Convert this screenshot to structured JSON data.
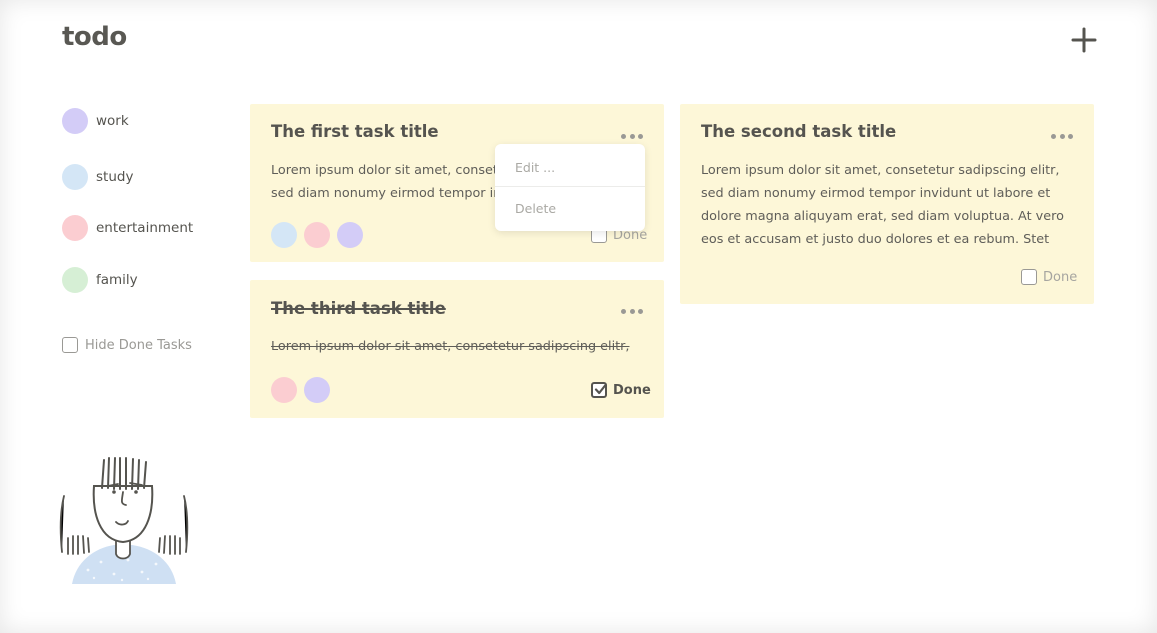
{
  "app": {
    "title": "todo"
  },
  "header": {
    "add_icon": "plus-icon"
  },
  "sidebar": {
    "tags": [
      {
        "label": "work",
        "color": "#d3ccf7"
      },
      {
        "label": "study",
        "color": "#d4e6f6"
      },
      {
        "label": "entertainment",
        "color": "#fbcdd1"
      },
      {
        "label": "family",
        "color": "#d6efd5"
      }
    ],
    "hide_done_label": "Hide Done Tasks"
  },
  "tasks": [
    {
      "title": "The first task title",
      "body_lines": [
        "Lorem ipsum dolor sit amet, consetetur sadipscing elitr,",
        "sed diam nonumy eirmod tempor invidunt ut labore et"
      ],
      "tag_colors": [
        "#d4e6f6",
        "#fbcdd1",
        "#d3ccf7"
      ],
      "done_label": "Done",
      "done": false
    },
    {
      "title": "The second task title",
      "body_lines": [
        "Lorem ipsum dolor sit amet, consetetur sadipscing elitr,",
        "sed diam nonumy eirmod tempor invidunt ut labore et",
        "dolore magna aliquyam erat, sed diam voluptua. At vero",
        "eos et accusam et justo duo dolores et ea rebum. Stet"
      ],
      "tag_colors": [],
      "done_label": "Done",
      "done": false
    },
    {
      "title": "The third task title",
      "body_lines": [
        "Lorem ipsum dolor sit amet, consetetur sadipscing elitr,"
      ],
      "tag_colors": [
        "#fbcdd1",
        "#d3ccf7"
      ],
      "done_label": "Done",
      "done": true
    }
  ],
  "context_menu": {
    "edit_label": "Edit ...",
    "delete_label": "Delete"
  },
  "colors": {
    "card_bg": "#fdf7d8",
    "text": "#55544f",
    "muted": "#a6a5a0"
  }
}
